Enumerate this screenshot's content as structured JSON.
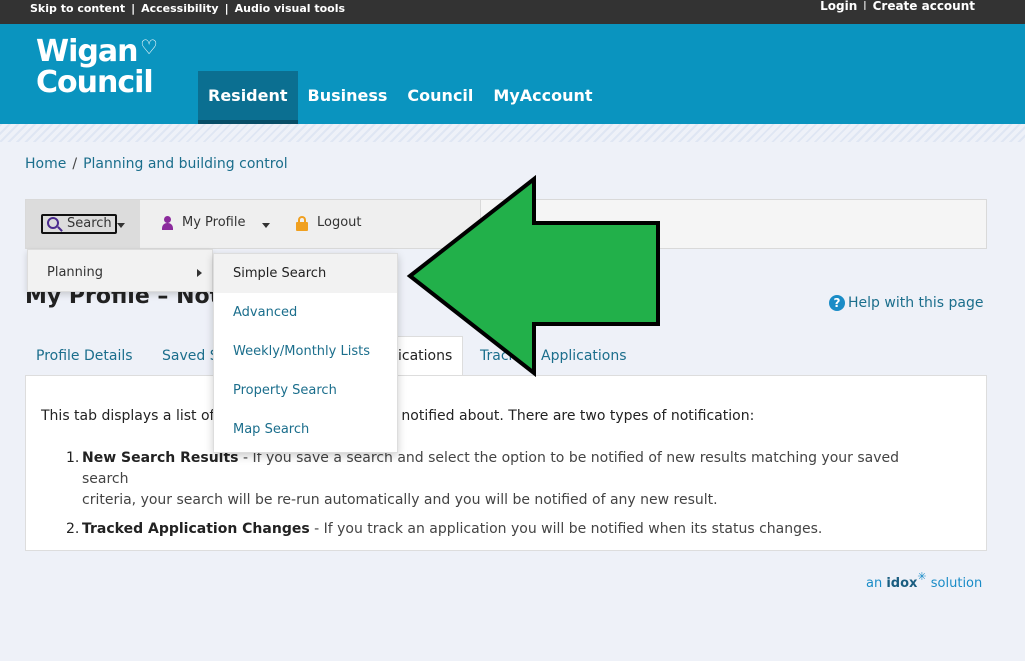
{
  "util": {
    "skip": "Skip to content",
    "sep": "|",
    "accessibility": "Accessibility",
    "audio": "Audio visual tools",
    "login": "Login",
    "create": "Create account"
  },
  "logo": {
    "line1": "Wigan",
    "line2": "Council"
  },
  "nav": [
    {
      "label": "Resident",
      "active": true
    },
    {
      "label": "Business"
    },
    {
      "label": "Council"
    },
    {
      "label": "MyAccount"
    }
  ],
  "breadcrumb": {
    "home": "Home",
    "sep": "/",
    "section": "Planning and building control"
  },
  "toolbar": {
    "search": "Search",
    "profile": "My Profile",
    "logout": "Logout"
  },
  "page": {
    "title": "My Profile – Notif",
    "help": "Help with this page"
  },
  "tabs": {
    "profile": "Profile Details",
    "saved": "Saved S",
    "notifications": "ications",
    "tracked": "Track",
    "applications": "Applications"
  },
  "panel": {
    "intro_a": "This tab displays a list of",
    "intro_b": "en notified about. There are two types of notification:",
    "items": [
      {
        "num": "1.",
        "title": "New Search Results",
        "desc_a": " - If you save a search and select the option to be notified of new results matching your saved search",
        "desc_b": "criteria, your search will be re-run automatically and you will be notified of any new result."
      },
      {
        "num": "2.",
        "title": "Tracked Application Changes",
        "desc_a": " - If you track an application you will be notified when its status changes."
      }
    ]
  },
  "menu": {
    "planning": "Planning",
    "items": [
      "Simple Search",
      "Advanced",
      "Weekly/Monthly Lists",
      "Property Search",
      "Map Search"
    ]
  },
  "footer": {
    "an": "an ",
    "idox": "idox",
    "solution": " solution"
  },
  "colors": {
    "header": "#0a94bf",
    "nav_active": "#0b6f91",
    "link": "#1b6e8c",
    "arrow": "#22b04a"
  }
}
